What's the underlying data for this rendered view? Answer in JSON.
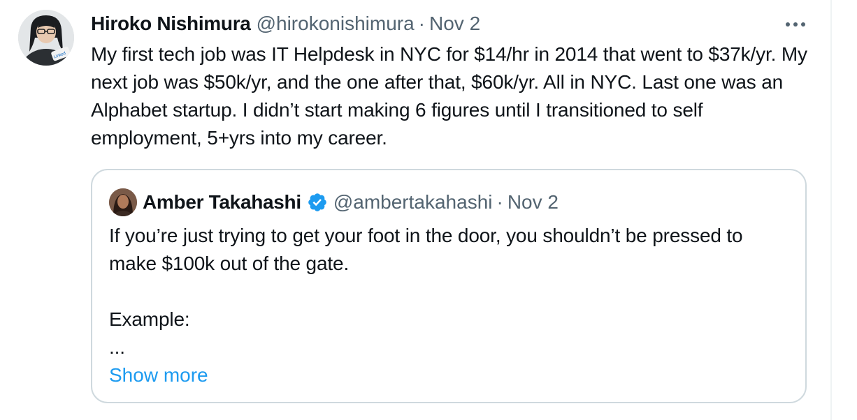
{
  "tweet": {
    "author_name": "Hiroko Nishimura",
    "author_handle": "@hirokonishimura",
    "separator": "·",
    "date": "Nov 2",
    "avatar_badge": "Linked",
    "text": "My first tech job was IT Helpdesk in NYC for $14/hr in 2014 that went to $37k/yr. My next job was $50k/yr, and the one after that, $60k/yr. All in NYC. Last one was an Alphabet startup. I didn’t start making 6 figures until I transitioned to self employment, 5+yrs into my career."
  },
  "quoted_tweet": {
    "author_name": "Amber Takahashi",
    "author_handle": "@ambertakahashi",
    "separator": "·",
    "date": "Nov 2",
    "verified": true,
    "line1": "If you’re just trying to get your foot in the door, you shouldn’t be pressed to make $100k out of the gate.",
    "line2": "Example:",
    "line3": "...",
    "show_more_label": "Show more"
  },
  "icons": {
    "more": "more-horizontal-icon",
    "verified": "verified-badge-icon"
  },
  "colors": {
    "text_primary": "#0f1419",
    "text_secondary": "#536471",
    "link": "#1d9bf0",
    "border": "#cfd9de",
    "verified": "#1d9bf0"
  }
}
